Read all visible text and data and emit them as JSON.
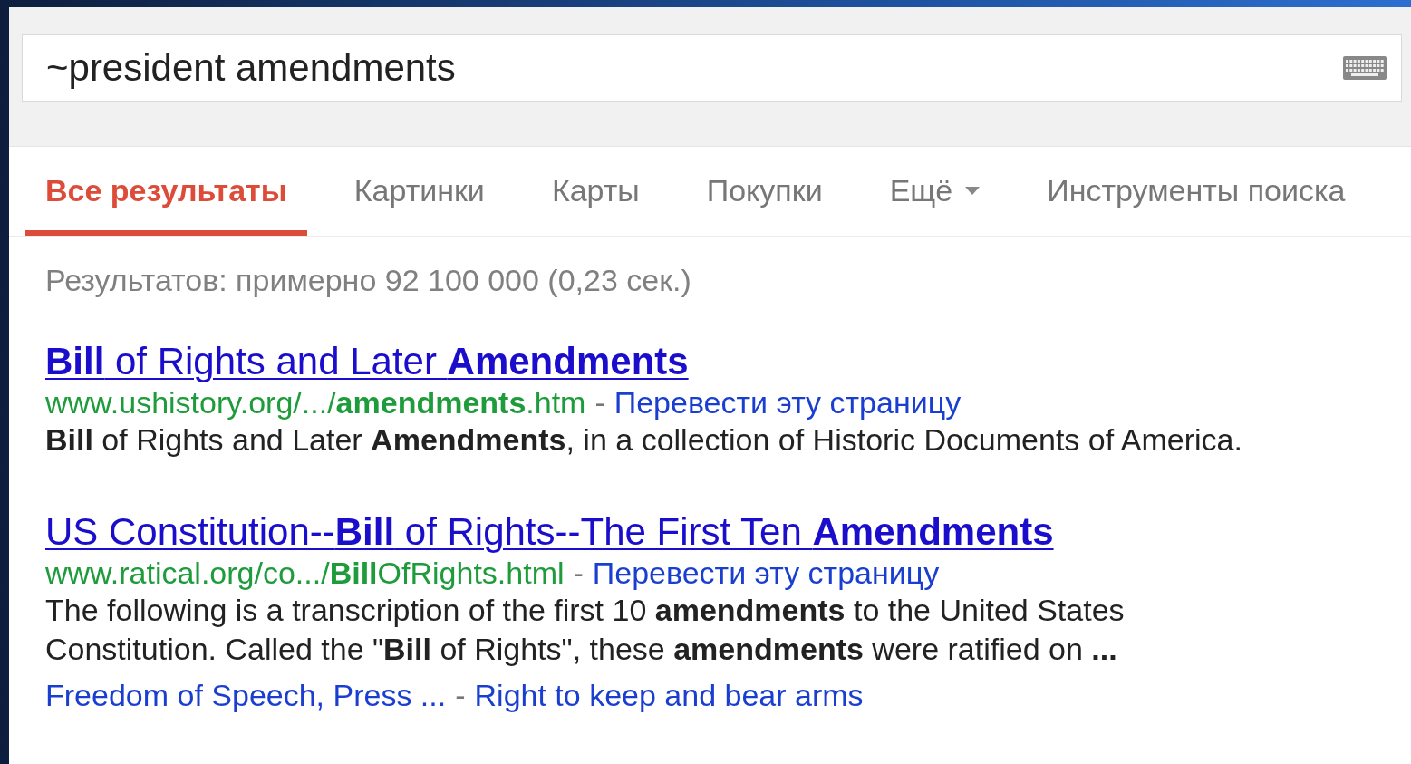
{
  "search": {
    "value": "~president amendments"
  },
  "tabs": [
    {
      "label": "Все результаты",
      "selected": true,
      "kind": "tab"
    },
    {
      "label": "Картинки",
      "selected": false,
      "kind": "tab"
    },
    {
      "label": "Карты",
      "selected": false,
      "kind": "tab"
    },
    {
      "label": "Покупки",
      "selected": false,
      "kind": "tab"
    },
    {
      "label": "Ещё",
      "selected": false,
      "kind": "dropdown"
    },
    {
      "label": "Инструменты поиска",
      "selected": false,
      "kind": "tools"
    }
  ],
  "result_stats": "Результатов: примерно 92 100 000 (0,23 сек.)",
  "results": [
    {
      "title": "**Bill** of Rights and Later **Amendments**",
      "url": "www.ushistory.org/.../**amendments**.htm",
      "separator": "-",
      "translate": "Перевести эту страницу",
      "snippet": "**Bill** of Rights and Later **Amendments**, in a collection of Historic Documents of America."
    },
    {
      "title": "US Constitution--**Bill** of Rights--The First Ten **Amendments**",
      "url": "www.ratical.org/co.../**Bill**OfRights.html",
      "separator": "-",
      "translate": "Перевести эту страницу",
      "snippet": "The following is a transcription of the first 10 **amendments** to the United States Constitution. Called the \"**Bill** of Rights\", these **amendments** were ratified on **...**",
      "sitelinks": [
        "Freedom of Speech, Press ...",
        "Right to keep and bear arms"
      ],
      "sitelinks_separator": "-"
    }
  ]
}
